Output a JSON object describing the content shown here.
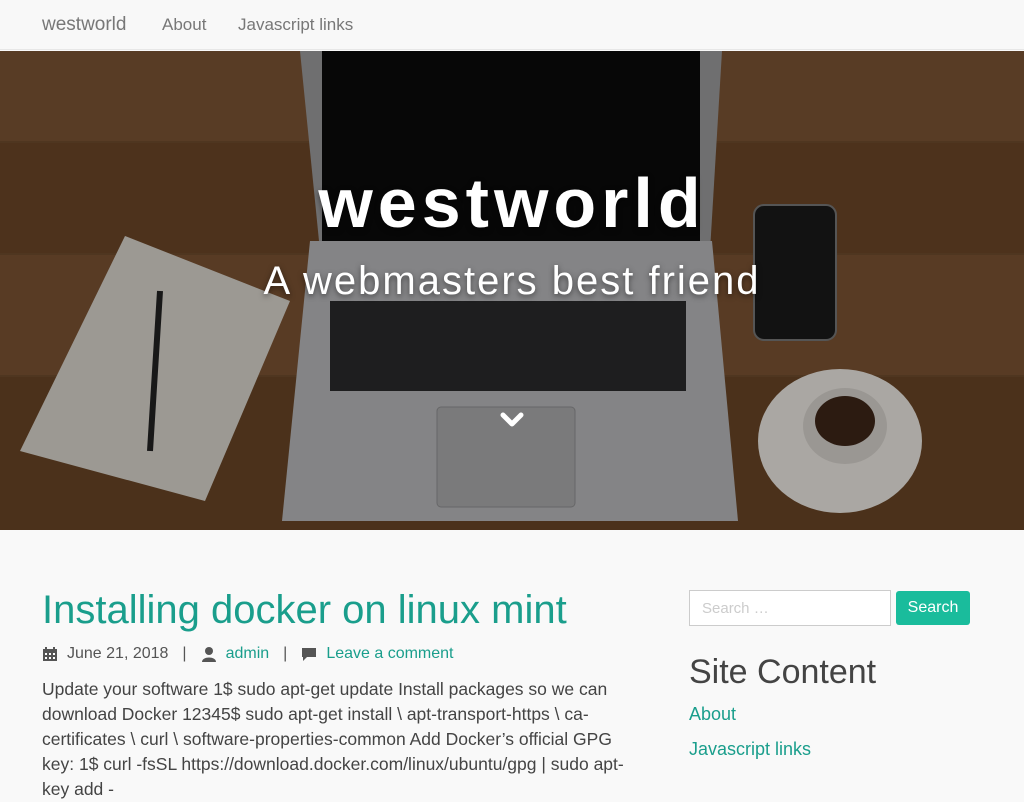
{
  "nav": {
    "brand": "westworld",
    "items": [
      {
        "label": "About"
      },
      {
        "label": "Javascript links"
      }
    ]
  },
  "hero": {
    "title": "westworld",
    "tagline": "A webmasters best friend",
    "scroll_icon": "chevron-down-icon"
  },
  "post": {
    "title": "Installing docker on linux mint",
    "date": "June 21, 2018",
    "author": "admin",
    "comment_link": "Leave a comment",
    "excerpt": "Update your software 1$ sudo apt-get update Install packages so we can download Docker 12345$ sudo apt-get install \\ apt-transport-https \\ ca-certificates \\ curl \\ software-properties-common Add Docker’s official GPG key: 1$ curl -fsSL https://download.docker.com/linux/ubuntu/gpg | sudo apt-key add -"
  },
  "sidebar": {
    "search": {
      "placeholder": "Search …",
      "button_label": "Search"
    },
    "widget_title": "Site Content",
    "links": [
      {
        "label": "About"
      },
      {
        "label": "Javascript links"
      }
    ]
  },
  "colors": {
    "accent": "#1abc9c",
    "link": "#1a9e8c"
  }
}
